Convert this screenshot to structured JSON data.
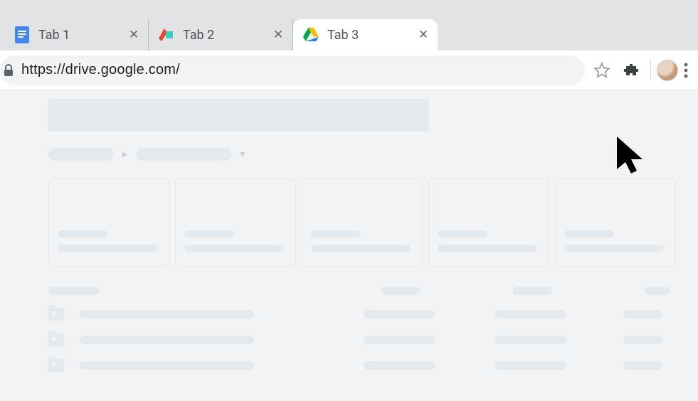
{
  "tabs": [
    {
      "label": "Tab 1",
      "active": false
    },
    {
      "label": "Tab 2",
      "active": false
    },
    {
      "label": "Tab 3",
      "active": true
    }
  ],
  "addressbar": {
    "url": "https://drive.google.com/"
  }
}
